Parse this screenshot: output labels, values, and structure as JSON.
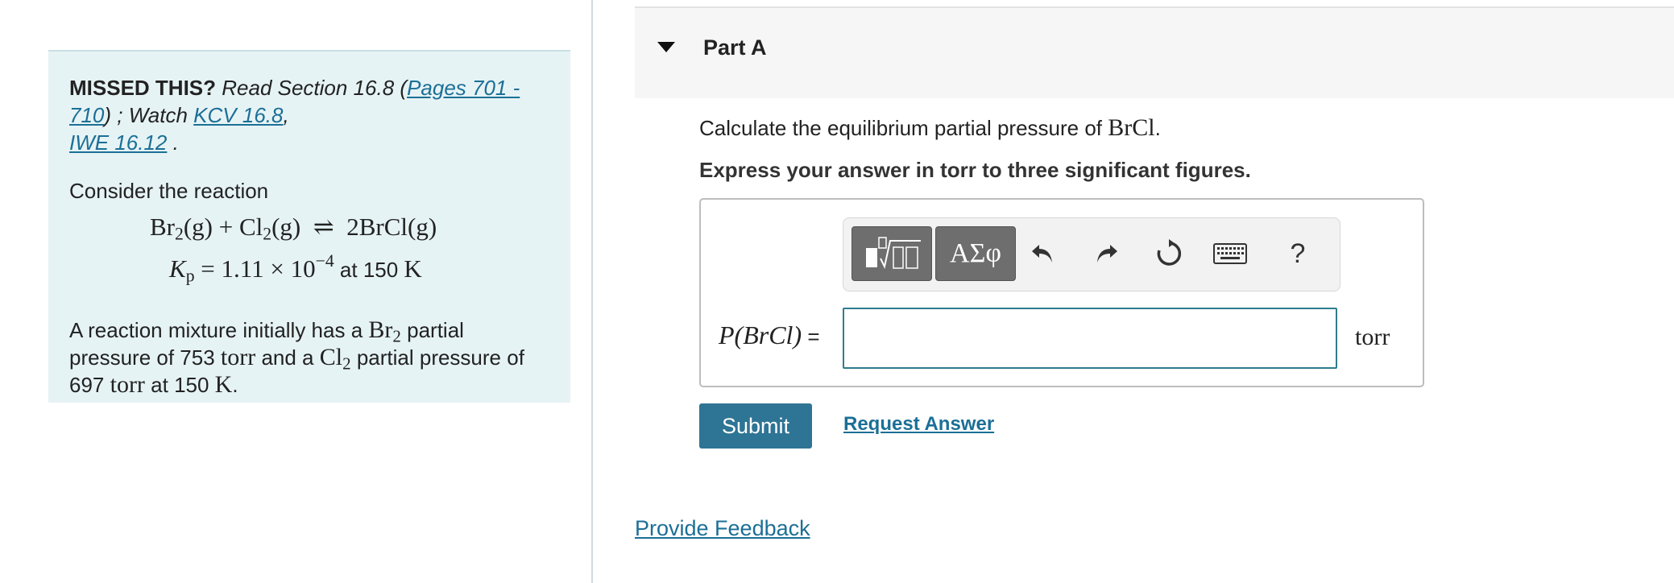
{
  "missed": {
    "bold": "MISSED THIS?",
    "read_section_pre": "Read Section 16.8 (",
    "pages_link": "Pages 701 - 710",
    "watch_pre": ") ; Watch ",
    "kcv_link": "KCV 16.8",
    "comma": ",",
    "iwe_link": "IWE 16.12",
    "period": " ."
  },
  "problem": {
    "consider": "Consider the reaction",
    "reaction": {
      "br": "Br",
      "br_sub": "2",
      "g1": "(g) + Cl",
      "cl_sub": "2",
      "g2": "(g)",
      "arrow": "⇌",
      "product": "2BrCl(g)"
    },
    "kp": {
      "k": "K",
      "k_sub": "p",
      "value": " = 1.11 × 10",
      "exp": "−4",
      "at": " at 150 ",
      "unit": "K"
    },
    "mixture": {
      "t1": "A reaction mixture initially has a ",
      "br": "Br",
      "br_sub": "2",
      "t2": " partial pressure of 753 ",
      "torr1": "torr",
      "t3": " and a ",
      "cl": "Cl",
      "cl_sub": "2",
      "t4": " partial pressure of 697 ",
      "torr2": "torr",
      "t5": " at 150 ",
      "k": "K",
      "t6": "."
    }
  },
  "part": {
    "title": "Part A",
    "question_pre": "Calculate the equilibrium partial pressure of ",
    "question_species": "BrCl",
    "question_post": ".",
    "instruction": "Express your answer in torr to three significant figures.",
    "symbols_label": "ΑΣφ",
    "help_label": "?",
    "answer_label": "P(BrCl)",
    "answer_eq": " =",
    "answer_value": "",
    "answer_unit": "torr",
    "submit_label": "Submit",
    "request_label": "Request Answer"
  },
  "feedback_label": "Provide Feedback",
  "colors": {
    "accent": "#2e7495",
    "link": "#1b6f96",
    "panel_bg": "#e6f3f5"
  }
}
